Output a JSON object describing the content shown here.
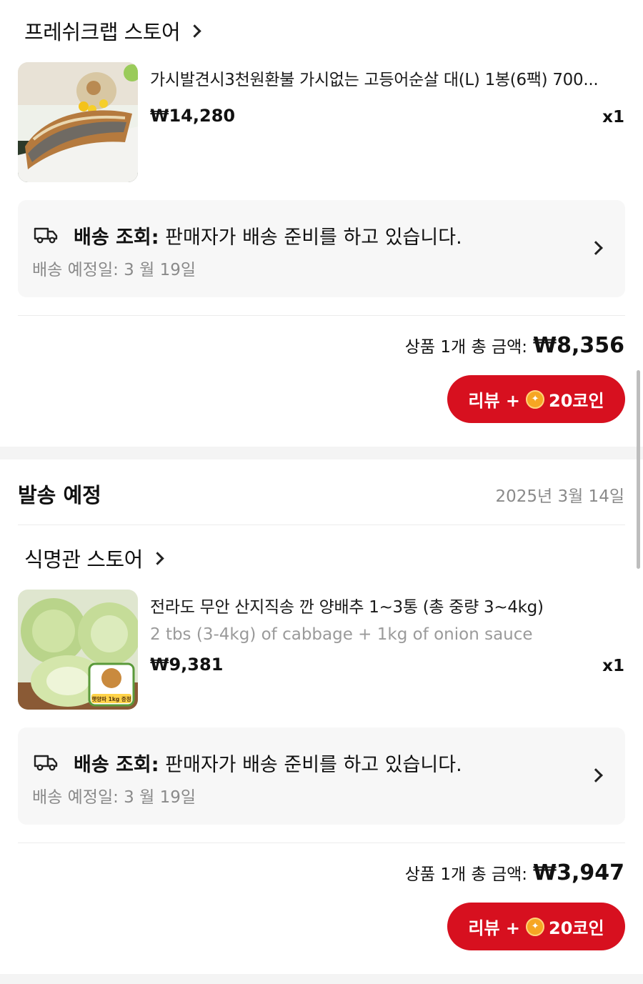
{
  "orders": [
    {
      "store_name": "프레쉬크랩 스토어",
      "product_title": "가시발견시3천원환불 가시없는 고등어순살 대(L) 1봉(6팩) 700...",
      "product_option": "",
      "price": "₩14,280",
      "qty": "x1",
      "delivery_label": "배송 조회:",
      "delivery_status": " 판매자가 배송 준비를 하고 있습니다.",
      "delivery_eta": "배송 예정일: 3 월 19일",
      "total_label": "상품 1개 총 금액:",
      "total_amount": "₩8,356",
      "review_label": "리뷰 +",
      "review_coin": "20코인"
    },
    {
      "store_name": "식명관 스토어",
      "product_title": "전라도 무안 산지직송 깐 양배추 1~3통 (총 중량 3~4kg)",
      "product_option": "2 tbs (3-4kg) of cabbage + 1kg of onion sauce",
      "thumb_badge": "햇양파 1kg 증정",
      "price": "₩9,381",
      "qty": "x1",
      "delivery_label": "배송 조회:",
      "delivery_status": " 판매자가 배송 준비를 하고 있습니다.",
      "delivery_eta": "배송 예정일: 3 월 19일",
      "total_label": "상품 1개 총 금액:",
      "total_amount": "₩3,947",
      "review_label": "리뷰 +",
      "review_coin": "20코인"
    }
  ],
  "section": {
    "title": "발송 예정",
    "date": "2025년 3월 14일"
  },
  "colors": {
    "accent": "#d7101f",
    "coin": "#f6a623",
    "muted": "#8a8a8a",
    "box_bg": "#f7f7f7"
  },
  "icons": [
    "chevron-right-icon",
    "truck-icon",
    "coin-icon"
  ]
}
